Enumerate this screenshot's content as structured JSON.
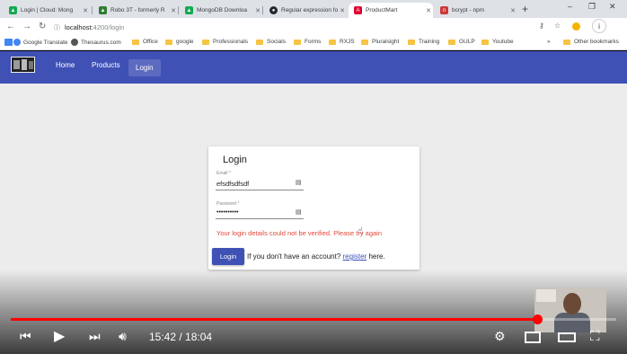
{
  "browser": {
    "tabs": [
      {
        "title": "Login | Cloud: Mong",
        "favicon_color": "#13aa52",
        "active": false
      },
      {
        "title": "Robo 3T - formerly R",
        "favicon_color": "#2e7d32",
        "active": false
      },
      {
        "title": "MongoDB Downloa",
        "favicon_color": "#13aa52",
        "active": false
      },
      {
        "title": "Regular expression fo",
        "favicon_color": "#24292e",
        "active": false
      },
      {
        "title": "ProductMart",
        "favicon_color": "#dd0031",
        "active": true
      },
      {
        "title": "bcrypt - npm",
        "favicon_color": "#cb3837",
        "active": false
      }
    ],
    "url": {
      "host": "localhost:",
      "path": "4200/login"
    },
    "bookmarks": [
      {
        "label": "Google Translate",
        "kind": "app"
      },
      {
        "label": "Thesaurus.com",
        "kind": "app"
      },
      {
        "label": "Office",
        "kind": "folder"
      },
      {
        "label": "google",
        "kind": "folder"
      },
      {
        "label": "Professionals",
        "kind": "folder"
      },
      {
        "label": "Socials",
        "kind": "folder"
      },
      {
        "label": "Forms",
        "kind": "folder"
      },
      {
        "label": "RXJS",
        "kind": "folder"
      },
      {
        "label": "Pluralsight",
        "kind": "folder"
      },
      {
        "label": "Training",
        "kind": "folder"
      },
      {
        "label": "GULP",
        "kind": "folder"
      },
      {
        "label": "Youtube",
        "kind": "folder"
      }
    ],
    "overflow_label": "»",
    "other_bookmarks": "Other bookmarks"
  },
  "app": {
    "nav": {
      "home": "Home",
      "products": "Products",
      "login": "Login"
    },
    "accent": "#3f51b5",
    "login": {
      "title": "Login",
      "email_label": "Email *",
      "email_value": "efsdfsdfsdf",
      "password_label": "Password *",
      "password_value": "••••••••••",
      "error": "Your login details could not be verified. Please try again",
      "button": "Login",
      "register_prefix": "If you don't have an account?",
      "register_link": "register",
      "register_suffix": "here."
    }
  },
  "video": {
    "current_time": "15:42",
    "duration": "18:04",
    "time_text": "15:42 / 18:04",
    "progress": 0.869
  }
}
